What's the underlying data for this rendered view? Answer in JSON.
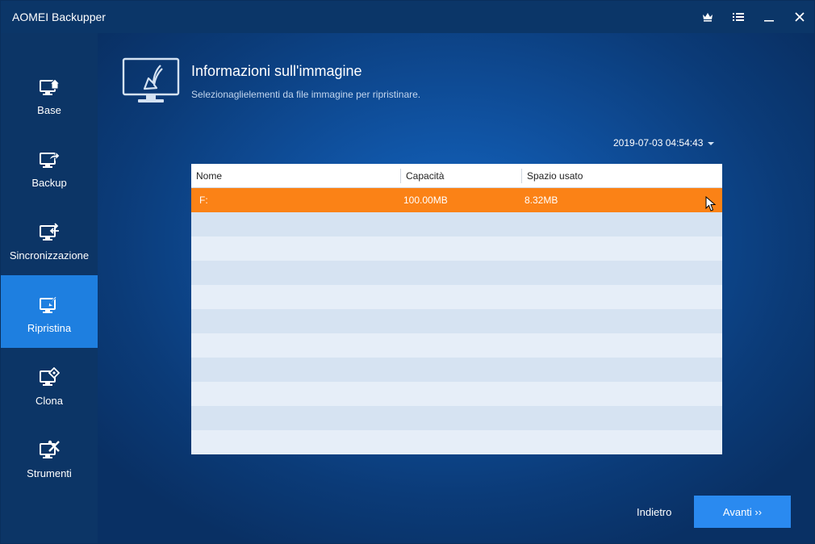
{
  "app": {
    "title": "AOMEI Backupper"
  },
  "titlebar_icons": [
    "crown-icon",
    "menu-icon",
    "minimize-icon",
    "close-icon"
  ],
  "sidebar": {
    "items": [
      {
        "label": "Base",
        "icon": "home-monitor-icon",
        "active": false
      },
      {
        "label": "Backup",
        "icon": "backup-monitor-icon",
        "active": false
      },
      {
        "label": "Sincronizzazione",
        "icon": "sync-monitor-icon",
        "active": false
      },
      {
        "label": "Ripristina",
        "icon": "restore-monitor-icon",
        "active": true
      },
      {
        "label": "Clona",
        "icon": "clone-monitor-icon",
        "active": false
      },
      {
        "label": "Strumenti",
        "icon": "tools-monitor-icon",
        "active": false
      }
    ]
  },
  "header": {
    "title": "Informazioni sull'immagine",
    "subtitle": "Selezionaglielementi da file immagine per ripristinare.",
    "icon": "restore-monitor-icon"
  },
  "backup_time": {
    "selected": "2019-07-03 04:54:43"
  },
  "table": {
    "columns": [
      "Nome",
      "Capacità",
      "Spazio usato"
    ],
    "rows": [
      {
        "name": "F:",
        "capacity": "100.00MB",
        "used": "8.32MB",
        "selected": true
      }
    ]
  },
  "footer": {
    "back_label": "Indietro",
    "next_label": "Avanti ››"
  },
  "colors": {
    "accent": "#1e7fe0",
    "selected_row": "#fb8216",
    "next_button": "#2a8af0",
    "titlebar": "#0b3668",
    "sidebar": "#0c3566"
  }
}
